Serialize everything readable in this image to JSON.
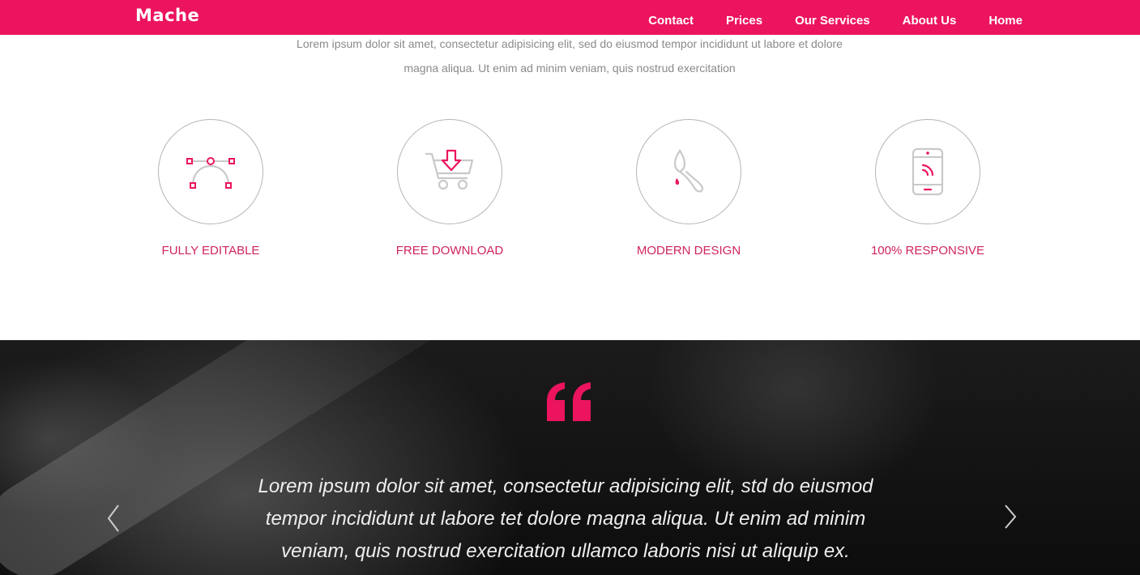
{
  "brand": {
    "name": "Mache"
  },
  "nav": {
    "items": [
      {
        "label": "Contact"
      },
      {
        "label": "Prices"
      },
      {
        "label": "Our Services"
      },
      {
        "label": "About Us"
      },
      {
        "label": "Home"
      }
    ]
  },
  "intro": {
    "text": "Lorem ipsum dolor sit amet, consectetur adipisicing elit, sed do eiusmod tempor incididunt ut labore et dolore magna aliqua. Ut enim ad minim veniam, quis nostrud exercitation"
  },
  "features": [
    {
      "label": "FULLY EDITABLE",
      "icon": "bezier-curve-icon"
    },
    {
      "label": "FREE DOWNLOAD",
      "icon": "cart-download-icon"
    },
    {
      "label": "MODERN DESIGN",
      "icon": "paint-brush-icon"
    },
    {
      "label": "100% RESPONSIVE",
      "icon": "mobile-phone-icon"
    }
  ],
  "testimonial": {
    "quote": "Lorem ipsum dolor sit amet, consectetur adipisicing elit, std do eiusmod tempor incididunt ut labore tet dolore magna aliqua. Ut enim ad minim veniam, quis nostrud exercitation ullamco laboris nisi ut aliquip ex.",
    "quote_icon": "quote-icon",
    "prev_icon": "chevron-left-icon",
    "next_icon": "chevron-right-icon"
  },
  "colors": {
    "accent": "#ec145f",
    "feature_label": "#d0245e",
    "body_text": "#8a8a8a"
  }
}
